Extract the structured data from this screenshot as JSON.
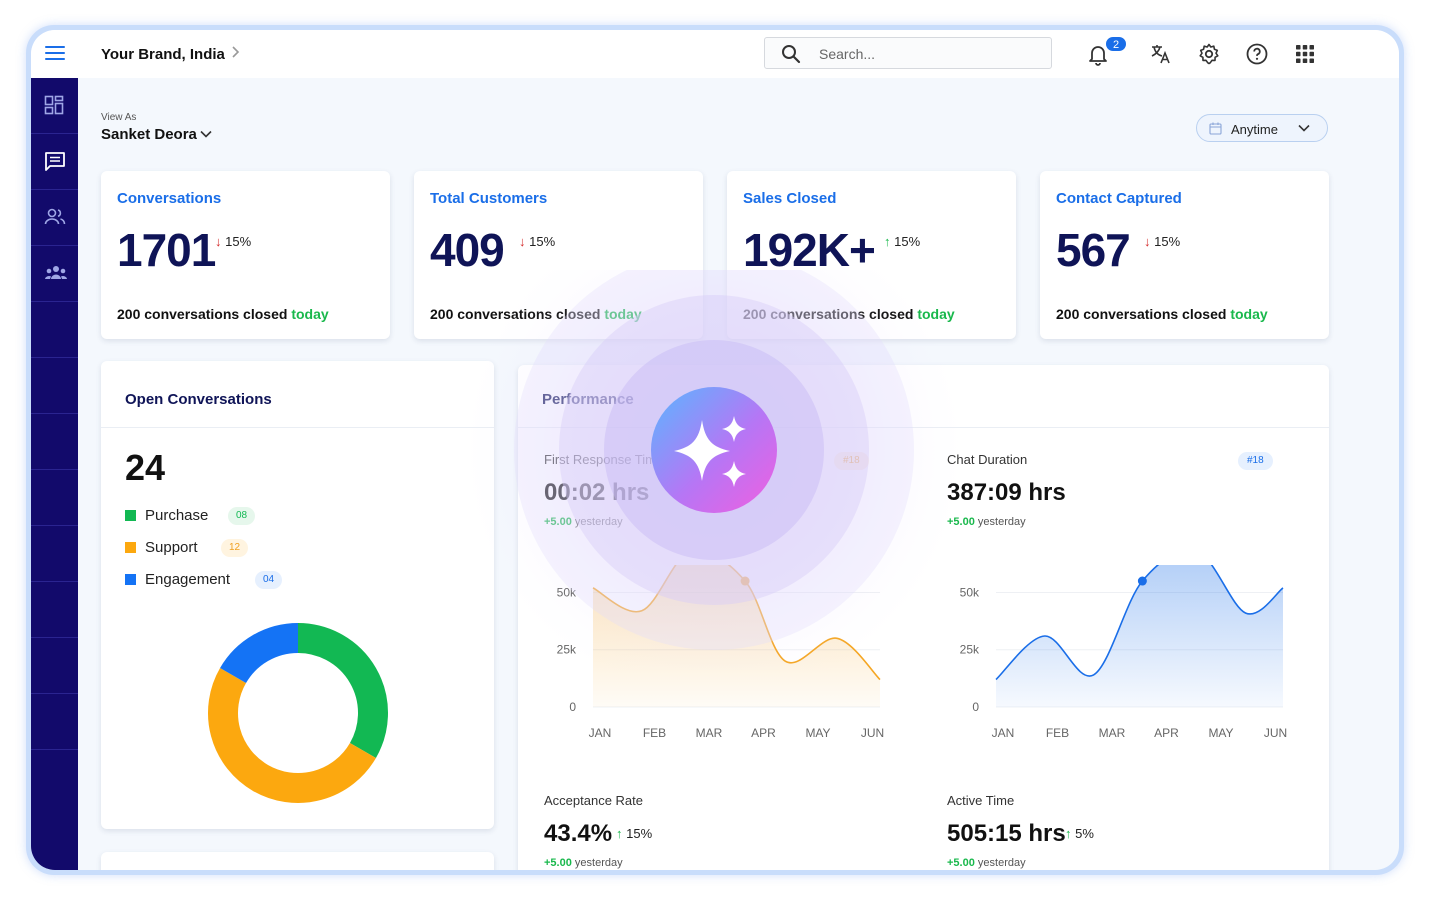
{
  "topbar": {
    "brand": "Your Brand, India",
    "search_placeholder": "Search...",
    "notification_count": "2"
  },
  "view_as": {
    "label": "View As",
    "name": "Sanket Deora"
  },
  "date_filter": {
    "label": "Anytime"
  },
  "kpis": [
    {
      "title": "Conversations",
      "value": "1701",
      "delta": "15%",
      "direction": "down",
      "foot": "200 conversations closed ",
      "foot_highlight": "today"
    },
    {
      "title": "Total Customers",
      "value": "409",
      "delta": "15%",
      "direction": "down",
      "foot": "200 conversations closed ",
      "foot_highlight": "today"
    },
    {
      "title": "Sales Closed",
      "value": "192K+",
      "delta": "15%",
      "direction": "up",
      "foot": "200 conversations closed ",
      "foot_highlight": "today"
    },
    {
      "title": "Contact Captured",
      "value": "567",
      "delta": "15%",
      "direction": "down",
      "foot": "200 conversations closed ",
      "foot_highlight": "today"
    }
  ],
  "open_conversations": {
    "title": "Open Conversations",
    "count": "24",
    "legend": [
      {
        "label": "Purchase",
        "count": "08",
        "color": "#12b853",
        "pill_bg": "#e6f7ec",
        "pill_color": "#12b853"
      },
      {
        "label": "Support",
        "count": "12",
        "color": "#fca80f",
        "pill_bg": "#fff4e0",
        "pill_color": "#f0a020"
      },
      {
        "label": "Engagement",
        "count": "04",
        "color": "#1473f5",
        "pill_bg": "#e6f0fe",
        "pill_color": "#1a6ee8"
      }
    ]
  },
  "chart_data": [
    {
      "type": "pie",
      "title": "",
      "categories": [
        "Purchase",
        "Support",
        "Engagement"
      ],
      "values": [
        8,
        12,
        4
      ],
      "colors": [
        "#12b853",
        "#fca80f",
        "#1473f5"
      ]
    },
    {
      "type": "area",
      "title": "First Response Time",
      "categories": [
        "JAN",
        "FEB",
        "MAR",
        "APR",
        "MAY",
        "JUN"
      ],
      "yticks": [
        "50k",
        "25k",
        "0"
      ],
      "ylim": [
        0,
        62000
      ],
      "series": [
        {
          "values": [
            52000,
            42000,
            68000,
            55000,
            20000,
            30000,
            12000
          ]
        }
      ],
      "x": [
        0,
        0.85,
        1.7,
        2.65,
        3.35,
        4.25,
        5.0
      ],
      "highlight_points": [
        2,
        3
      ],
      "color": "#f5a623"
    },
    {
      "type": "area",
      "title": "Chat Duration",
      "categories": [
        "JAN",
        "FEB",
        "MAR",
        "APR",
        "MAY",
        "JUN"
      ],
      "yticks": [
        "50k",
        "25k",
        "0"
      ],
      "ylim": [
        0,
        62000
      ],
      "series": [
        {
          "values": [
            12000,
            31000,
            14000,
            55000,
            68000,
            41000,
            52000
          ]
        }
      ],
      "x": [
        0,
        0.85,
        1.7,
        2.55,
        3.5,
        4.35,
        5.0
      ],
      "highlight_points": [
        3,
        4
      ],
      "color": "#1a6ee8"
    }
  ],
  "performance": {
    "title": "Performance",
    "metrics": [
      {
        "title": "First Response Time",
        "value": "00:02 hrs",
        "sub_delta": "+5.00",
        "sub_text": " yesterday",
        "rank": "#18"
      },
      {
        "title": "Chat Duration",
        "value": "387:09 hrs",
        "sub_delta": "+5.00",
        "sub_text": " yesterday",
        "rank": "#18"
      },
      {
        "title": "Acceptance Rate",
        "value": "43.4%",
        "delta": "15%",
        "sub_delta": "+5.00",
        "sub_text": " yesterday"
      },
      {
        "title": "Active Time",
        "value": "505:15 hrs",
        "delta": "5%",
        "sub_delta": "+5.00",
        "sub_text": " yesterday"
      }
    ]
  },
  "icons": {
    "topbar": [
      "menu-icon",
      "chevron-right-icon",
      "search-icon",
      "bell-icon",
      "translate-icon",
      "gear-icon",
      "help-icon",
      "apps-grid-icon"
    ],
    "sidebar": [
      "dashboard-icon",
      "chat-icon",
      "users-icon",
      "team-icon"
    ]
  },
  "colors": {
    "primary": "#1a6ee8",
    "sidebar": "#120a6b",
    "navy_text": "#0f1457",
    "green": "#19b84c",
    "red": "#d42a2a"
  }
}
